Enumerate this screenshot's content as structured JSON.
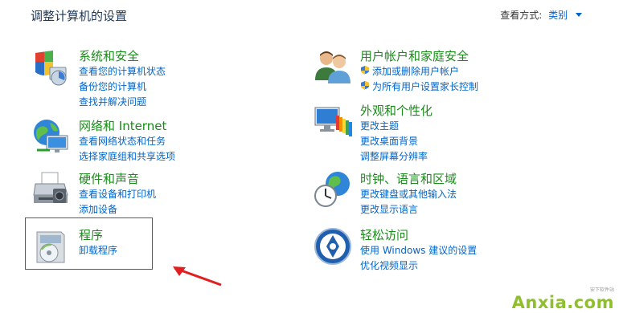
{
  "header": {
    "title": "调整计算机的设置",
    "view_by_label": "查看方式:",
    "view_by_value": "类别"
  },
  "categories": [
    {
      "key": "system-security",
      "title": "系统和安全",
      "icon": "shield-pc-icon",
      "links": [
        "查看您的计算机状态",
        "备份您的计算机",
        "查找并解决问题"
      ]
    },
    {
      "key": "network",
      "title": "网络和 Internet",
      "icon": "network-globe-icon",
      "links": [
        "查看网络状态和任务",
        "选择家庭组和共享选项"
      ]
    },
    {
      "key": "hardware-sound",
      "title": "硬件和声音",
      "icon": "printer-icon",
      "links": [
        "查看设备和打印机",
        "添加设备"
      ]
    },
    {
      "key": "programs",
      "title": "程序",
      "icon": "programs-disc-icon",
      "links": [
        "卸载程序"
      ]
    },
    {
      "key": "user-accounts",
      "title": "用户帐户和家庭安全",
      "icon": "users-icon",
      "links": [
        "添加或删除用户帐户",
        "为所有用户设置家长控制"
      ]
    },
    {
      "key": "appearance",
      "title": "外观和个性化",
      "icon": "monitor-palette-icon",
      "links": [
        "更改主题",
        "更改桌面背景",
        "调整屏幕分辨率"
      ]
    },
    {
      "key": "clock-region",
      "title": "时钟、语言和区域",
      "icon": "clock-globe-icon",
      "links": [
        "更改键盘或其他输入法",
        "更改显示语言"
      ]
    },
    {
      "key": "ease-of-access",
      "title": "轻松访问",
      "icon": "accessibility-icon",
      "links": [
        "使用 Windows 建议的设置",
        "优化视频显示"
      ]
    }
  ],
  "watermark": {
    "text": "Anxia.com",
    "sub": "安下软件站"
  },
  "colors": {
    "title_green": "#1a8c1a",
    "link_blue": "#0066cc",
    "highlight_red": "#e02020"
  }
}
